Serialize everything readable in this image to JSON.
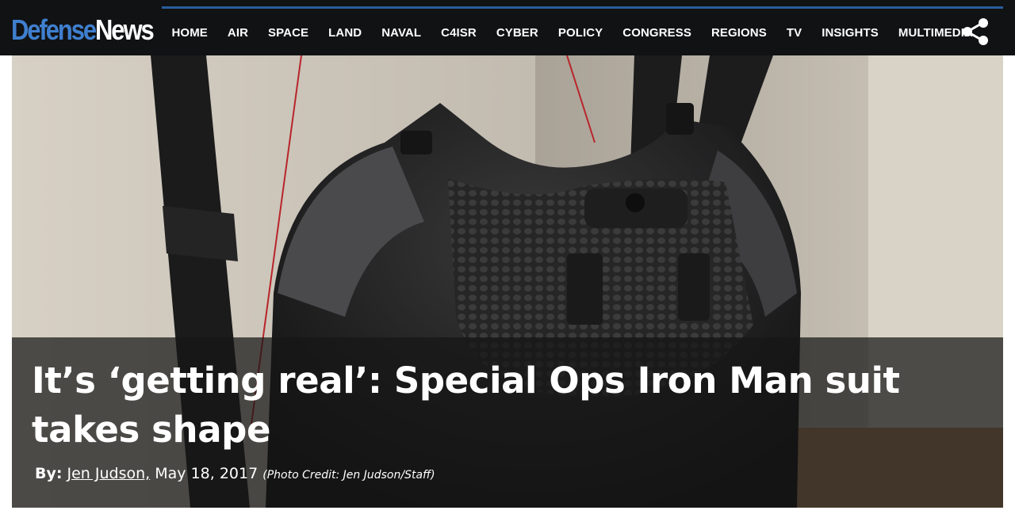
{
  "site": {
    "logo_part1": "Defense",
    "logo_part2": "News",
    "accent_color": "#3f7fcf"
  },
  "nav": {
    "items": [
      "HOME",
      "AIR",
      "SPACE",
      "LAND",
      "NAVAL",
      "C4ISR",
      "CYBER",
      "POLICY",
      "CONGRESS",
      "REGIONS",
      "TV",
      "INSIGHTS",
      "MULTIMEDIA"
    ],
    "share_icon": "share-icon"
  },
  "article": {
    "headline": "It’s ‘getting real’: Special Ops Iron Man suit takes shape",
    "byline_prefix": "By:",
    "author": "Jen Judson,",
    "date": "May 18, 2017",
    "photo_credit": "(Photo Credit: Jen Judson/Staff)"
  }
}
